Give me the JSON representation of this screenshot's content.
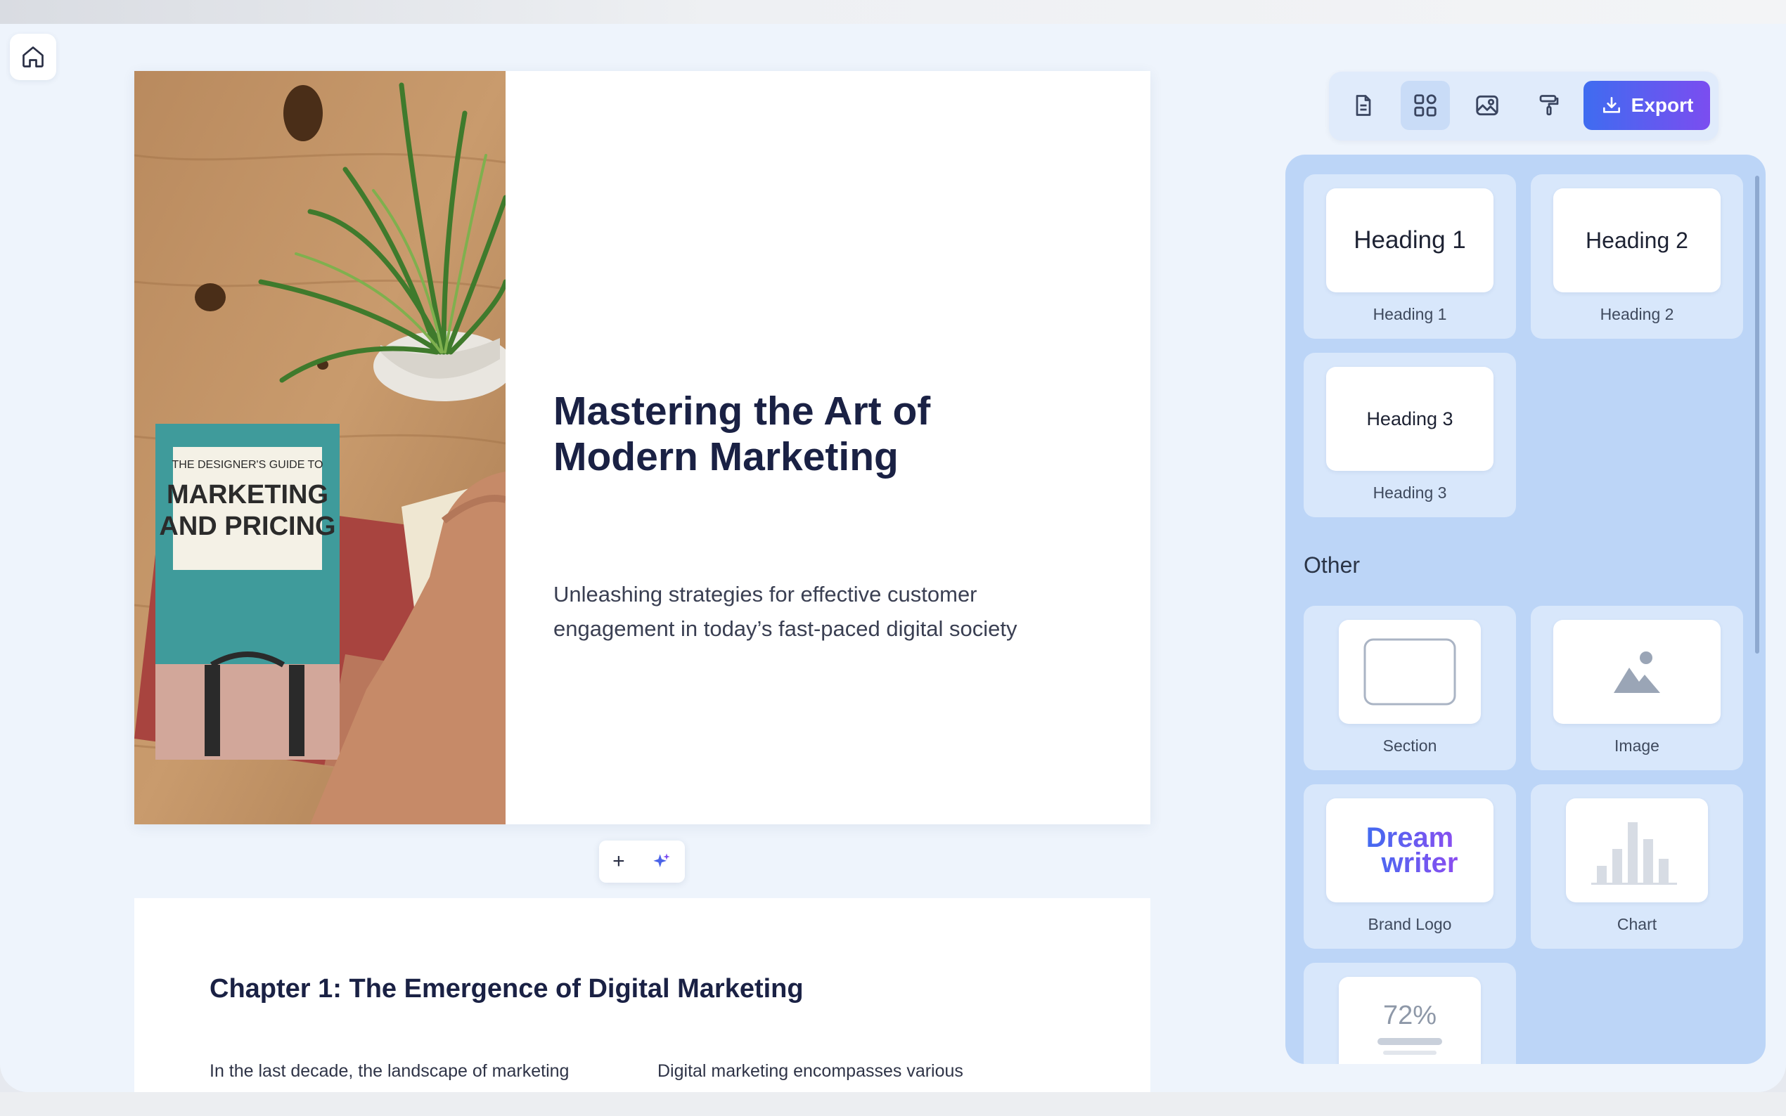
{
  "document": {
    "cover": {
      "title_line1": "Mastering the Art of",
      "title_line2": "Modern Marketing",
      "subtitle_line1": "Unleashing strategies for effective customer",
      "subtitle_line2": "engagement in today’s fast-paced digital society",
      "book_line1": "THE DESIGNER'S GUIDE TO",
      "book_line2": "MARKETING",
      "book_line3": "AND PRICING"
    },
    "chapter1": {
      "heading": "Chapter 1: The Emergence of Digital Marketing",
      "col1_line1": "In the last decade, the landscape of marketing",
      "col2_line1": "Digital marketing encompasses various"
    },
    "add_toolbar": {
      "plus": "+"
    }
  },
  "toolbar": {
    "export_label": "Export",
    "accent_start": "#3f6cf0",
    "accent_end": "#7b4df0"
  },
  "panel": {
    "headings": [
      {
        "preview": "Heading 1",
        "label": "Heading 1"
      },
      {
        "preview": "Heading 2",
        "label": "Heading 2"
      },
      {
        "preview": "Heading 3",
        "label": "Heading 3"
      }
    ],
    "other_title": "Other",
    "other": [
      {
        "label": "Section"
      },
      {
        "label": "Image"
      },
      {
        "preview_line1": "Dream",
        "preview_line2": "writer",
        "label": "Brand Logo"
      },
      {
        "label": "Chart"
      },
      {
        "preview": "72%"
      }
    ]
  }
}
